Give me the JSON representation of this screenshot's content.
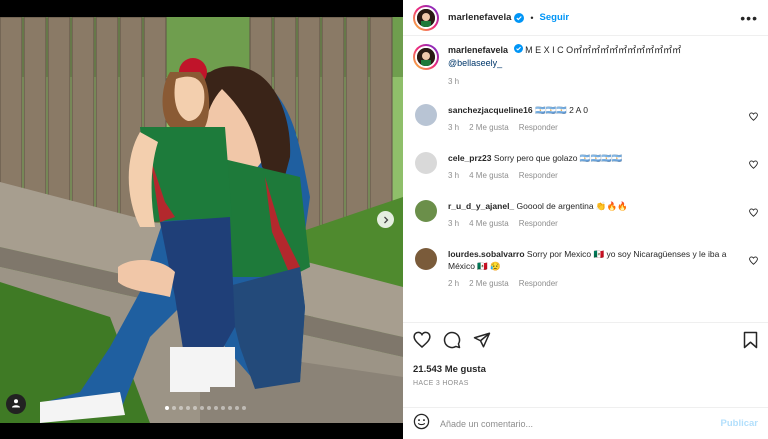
{
  "post": {
    "author": "marlenefavela",
    "follow_label": "Seguir",
    "separator": "•",
    "more_label": "•••",
    "caption_text": "M E X I C O㎡㎡㎡㎡㎡㎡㎡㎡㎡㎡㎡㎡",
    "caption_mention": "@bellaseely_",
    "caption_time": "3 h",
    "carousel": {
      "slides": 12,
      "active_index": 0
    },
    "icons": {
      "verified": "verified-badge-icon",
      "like": "heart-icon",
      "comment": "comment-icon",
      "share": "share-icon",
      "save": "bookmark-icon",
      "emoji": "emoji-icon",
      "next": "chevron-right-icon",
      "tag": "user-tag-icon"
    },
    "colors": {
      "link": "#0095f6",
      "mention": "#00376b",
      "muted": "#8e8e8e",
      "text": "#262626"
    }
  },
  "comments": [
    {
      "username": "sanchezjacqueline16",
      "text": "🇦🇷🇦🇷🇦🇷 2 A 0",
      "time": "3 h",
      "likes": "2 Me gusta",
      "reply": "Responder"
    },
    {
      "username": "cele_prz23",
      "text": "Sorry pero que golazo 🇦🇷🇦🇷🇦🇷🇦🇷",
      "time": "3 h",
      "likes": "4 Me gusta",
      "reply": "Responder"
    },
    {
      "username": "r_u_d_y_ajanel_",
      "text": "Gooool de argentina 👏🔥🔥",
      "time": "3 h",
      "likes": "4 Me gusta",
      "reply": "Responder"
    },
    {
      "username": "lourdes.sobalvarro",
      "text": "Sorry por Mexico 🇲🇽 yo soy Nicaragüenses y le iba a México 🇲🇽 😥",
      "time": "2 h",
      "likes": "2 Me gusta",
      "reply": "Responder"
    }
  ],
  "footer": {
    "likes": "21.543 Me gusta",
    "time": "HACE 3 HORAS",
    "comment_placeholder": "Añade un comentario...",
    "publish_label": "Publicar"
  }
}
